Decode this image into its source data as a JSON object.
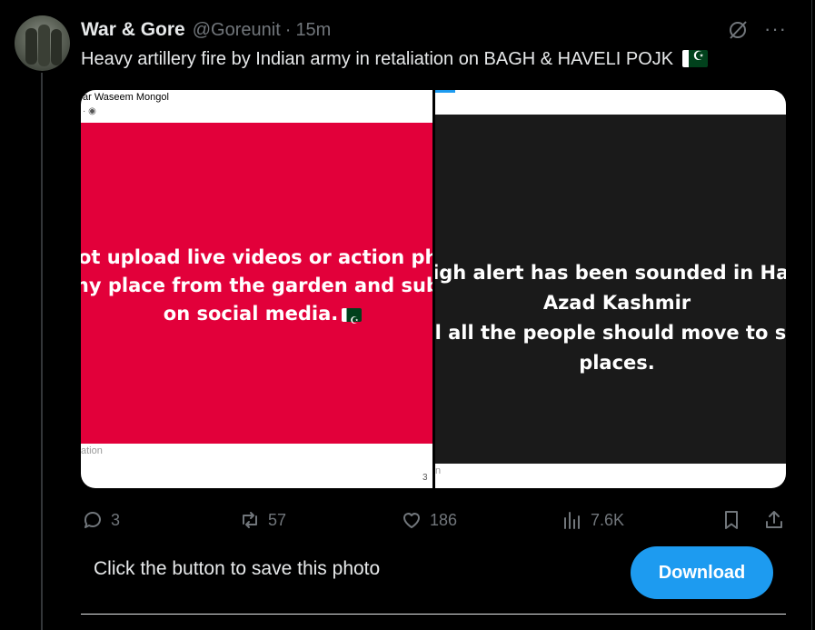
{
  "tweet": {
    "author_name": "War & Gore",
    "handle": "@Goreunit",
    "separator": "·",
    "time": "15m",
    "text": "Heavy artillery fire by Indian army in retaliation on BAGH & HAVELI POJK",
    "text_emoji": "pakistan-flag"
  },
  "media": {
    "left": {
      "top_name": "ar Waseem Mongol",
      "lines": [
        "not upload live videos or action phot",
        "any place from the garden and subur",
        "on social media."
      ],
      "footer": "ation",
      "page": "3",
      "bg_color": "#e2003a"
    },
    "right": {
      "lines": [
        "igh alert has been sounded in Hav",
        "Azad Kashmir",
        "l all the people should move to sa",
        "places."
      ],
      "footer": "n",
      "bg_color": "#1a1a1a"
    }
  },
  "actions": {
    "replies": "3",
    "reposts": "57",
    "likes": "186",
    "views": "7.6K"
  },
  "save_prompt": {
    "text": "Click the button to save this photo",
    "button_label": "Download",
    "accent": "#1d9bf0"
  }
}
